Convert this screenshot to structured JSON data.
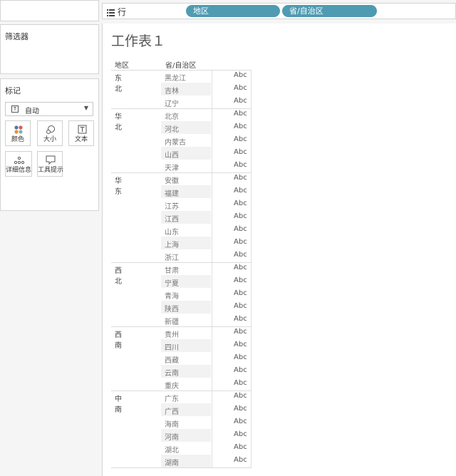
{
  "shelf": {
    "label": "行",
    "pills": [
      "地区",
      "省/自治区"
    ]
  },
  "filters": {
    "title": "筛选器"
  },
  "marks": {
    "title": "标记",
    "type_glyph": "T",
    "type_label": "自动",
    "buttons": [
      {
        "label": "颜色",
        "icon": "color-dots-icon"
      },
      {
        "label": "大小",
        "icon": "size-icon"
      },
      {
        "label": "文本",
        "icon": "text-icon"
      },
      {
        "label": "详细信息",
        "icon": "detail-dots-icon"
      },
      {
        "label": "工具提示",
        "icon": "tooltip-icon"
      }
    ]
  },
  "sheet": {
    "title": "工作表１",
    "headers": [
      "地区",
      "省/自治区"
    ],
    "cell_text": "Abc",
    "groups": [
      {
        "region": "东北",
        "provinces": [
          "黑龙江",
          "吉林",
          "辽宁"
        ]
      },
      {
        "region": "华北",
        "provinces": [
          "北京",
          "河北",
          "内蒙古",
          "山西",
          "天津"
        ]
      },
      {
        "region": "华东",
        "provinces": [
          "安徽",
          "福建",
          "江苏",
          "江西",
          "山东",
          "上海",
          "浙江"
        ]
      },
      {
        "region": "西北",
        "provinces": [
          "甘肃",
          "宁夏",
          "青海",
          "陕西",
          "新疆"
        ]
      },
      {
        "region": "西南",
        "provinces": [
          "贵州",
          "四川",
          "西藏",
          "云南",
          "重庆"
        ]
      },
      {
        "region": "中南",
        "provinces": [
          "广东",
          "广西",
          "海南",
          "河南",
          "湖北",
          "湖南"
        ]
      }
    ]
  }
}
